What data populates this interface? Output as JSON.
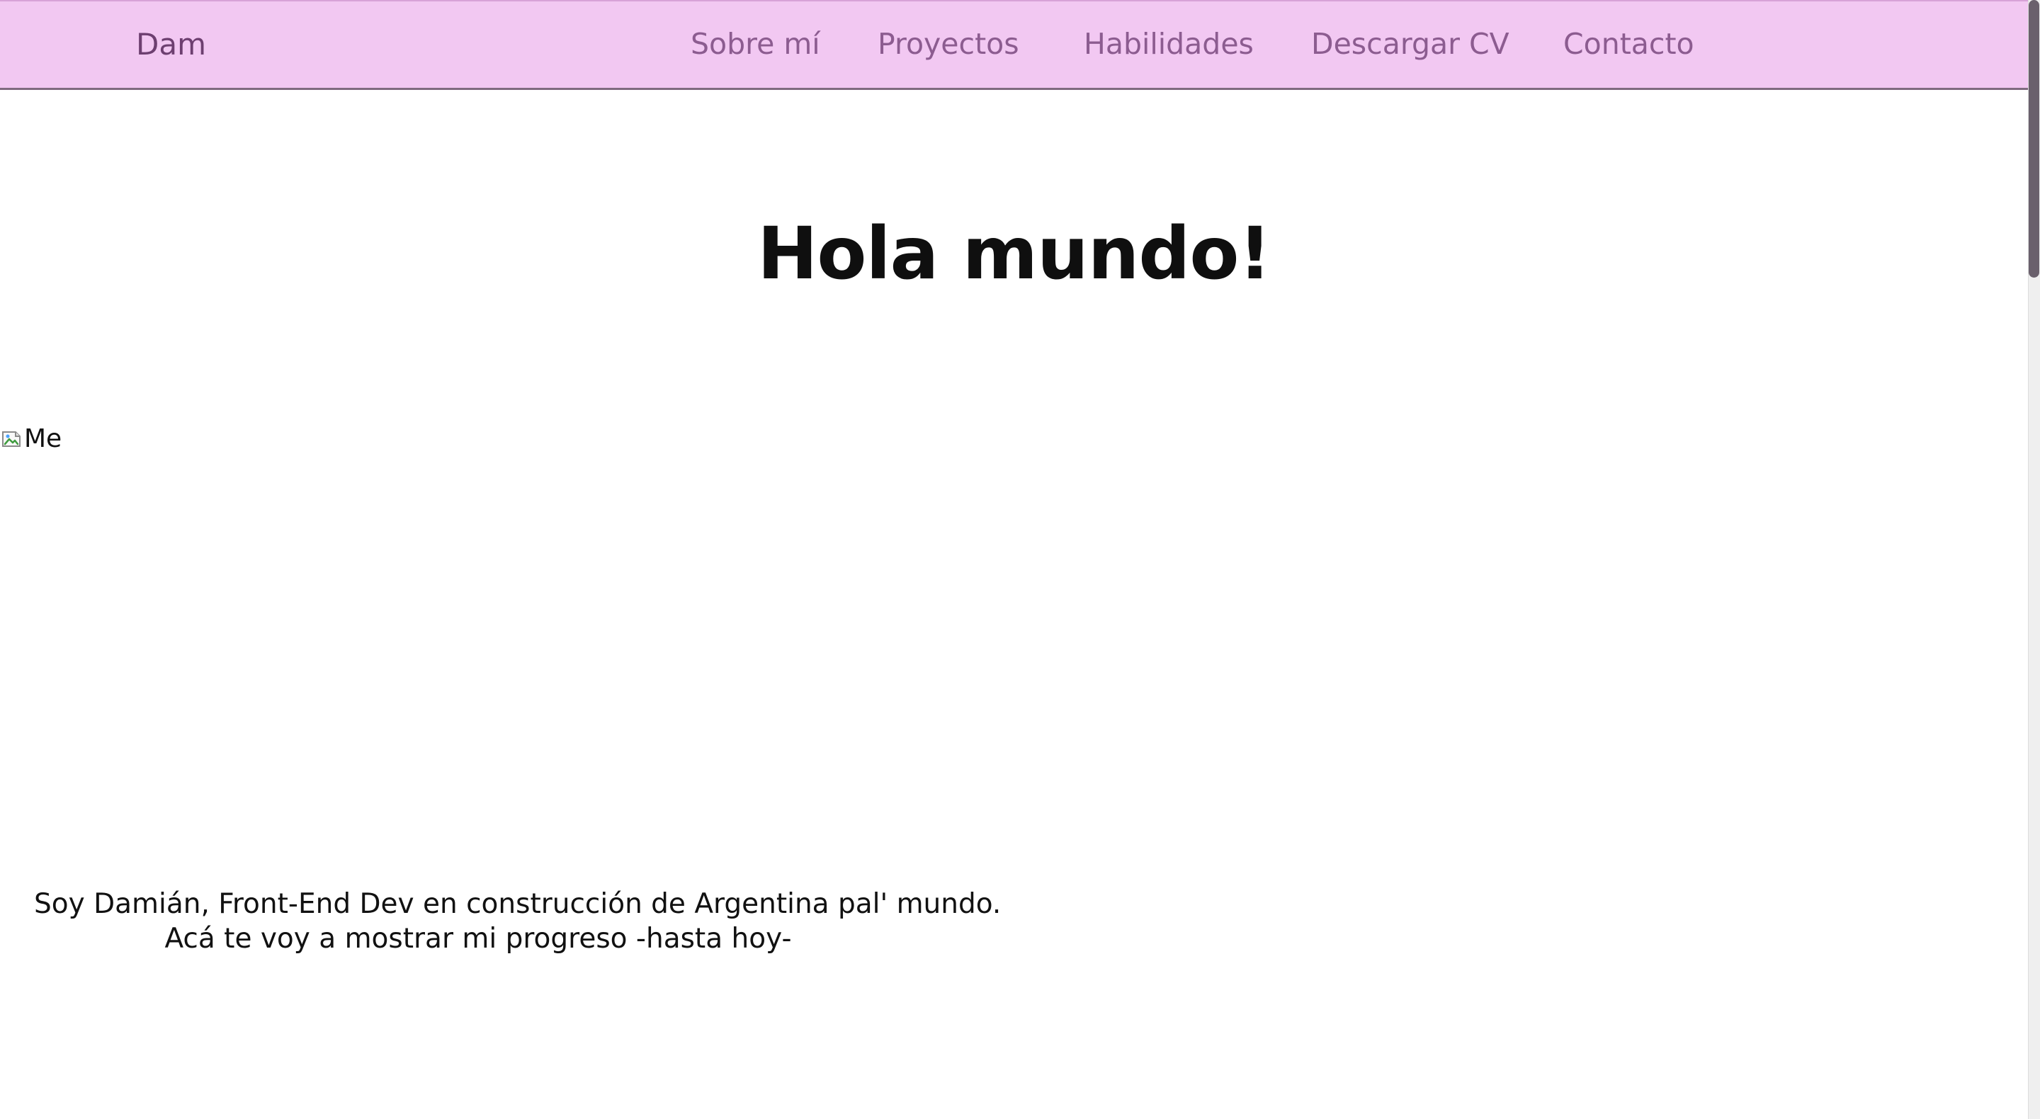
{
  "nav": {
    "brand": "Dam",
    "items": [
      {
        "label": "Sobre mí"
      },
      {
        "label": "Proyectos"
      },
      {
        "label": "Habilidades"
      },
      {
        "label": "Descargar CV"
      },
      {
        "label": "Contacto"
      }
    ]
  },
  "hero": {
    "title": "Hola mundo!",
    "image_alt": "Me",
    "intro_lines": [
      "Soy Damián, Front-End Dev en construcción de Argentina pal' mundo.",
      "Acá te voy a mostrar mi progreso -hasta hoy-"
    ]
  },
  "icons": {
    "broken_image": "broken-image-icon"
  },
  "colors": {
    "nav_background": "#f2c8f2",
    "nav_text": "#8c5c90",
    "brand_text": "#6d3f70",
    "title_text": "#0f0f0f"
  }
}
